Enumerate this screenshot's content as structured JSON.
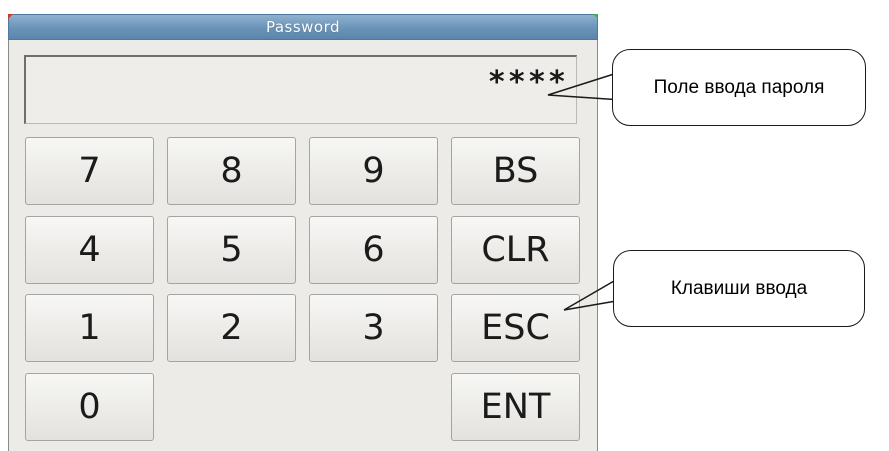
{
  "dialog": {
    "title": "Password",
    "password_value": "****",
    "keys": {
      "k7": "7",
      "k8": "8",
      "k9": "9",
      "bs": "BS",
      "k4": "4",
      "k5": "5",
      "k6": "6",
      "clr": "CLR",
      "k1": "1",
      "k2": "2",
      "k3": "3",
      "esc": "ESC",
      "k0": "0",
      "ent": "ENT"
    }
  },
  "callouts": {
    "field": "Поле ввода пароля",
    "keys": "Клавиши ввода"
  },
  "colors": {
    "titlebar": "#6a93b8",
    "dialog_bg": "#ecebe8",
    "key_bg": "#efeeeb",
    "close_corner": "#38b348",
    "left_corner": "#d9322c"
  }
}
